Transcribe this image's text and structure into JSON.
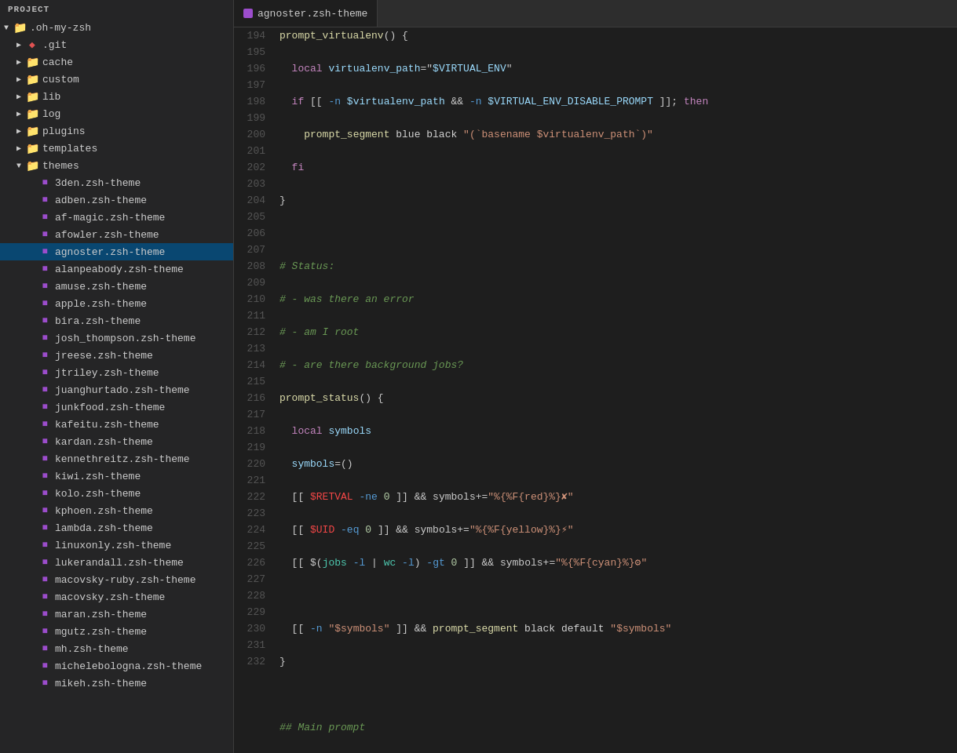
{
  "sidebar": {
    "header": "Project",
    "root": ".oh-my-zsh",
    "items": [
      {
        "id": "git",
        "label": ".git",
        "type": "folder",
        "depth": 1,
        "collapsed": true
      },
      {
        "id": "cache",
        "label": "cache",
        "type": "folder",
        "depth": 1,
        "collapsed": true
      },
      {
        "id": "custom",
        "label": "custom",
        "type": "folder",
        "depth": 1,
        "collapsed": true
      },
      {
        "id": "lib",
        "label": "lib",
        "type": "folder",
        "depth": 1,
        "collapsed": true
      },
      {
        "id": "log",
        "label": "log",
        "type": "folder",
        "depth": 1,
        "collapsed": true
      },
      {
        "id": "plugins",
        "label": "plugins",
        "type": "folder",
        "depth": 1,
        "collapsed": true
      },
      {
        "id": "templates",
        "label": "templates",
        "type": "folder",
        "depth": 1,
        "collapsed": true
      },
      {
        "id": "themes",
        "label": "themes",
        "type": "folder",
        "depth": 1,
        "collapsed": false
      },
      {
        "id": "3den",
        "label": "3den.zsh-theme",
        "type": "file-zsh",
        "depth": 2
      },
      {
        "id": "adben",
        "label": "adben.zsh-theme",
        "type": "file-zsh",
        "depth": 2
      },
      {
        "id": "af-magic",
        "label": "af-magic.zsh-theme",
        "type": "file-zsh",
        "depth": 2
      },
      {
        "id": "afowler",
        "label": "afowler.zsh-theme",
        "type": "file-zsh",
        "depth": 2
      },
      {
        "id": "agnoster",
        "label": "agnoster.zsh-theme",
        "type": "file-zsh",
        "depth": 2,
        "selected": true
      },
      {
        "id": "alanpeabody",
        "label": "alanpeabody.zsh-theme",
        "type": "file-zsh",
        "depth": 2
      },
      {
        "id": "amuse",
        "label": "amuse.zsh-theme",
        "type": "file-zsh",
        "depth": 2
      },
      {
        "id": "apple",
        "label": "apple.zsh-theme",
        "type": "file-zsh",
        "depth": 2
      },
      {
        "id": "bira",
        "label": "bira.zsh-theme",
        "type": "file-zsh",
        "depth": 2
      },
      {
        "id": "josh_thompson",
        "label": "josh_thompson.zsh-theme",
        "type": "file-zsh",
        "depth": 2
      },
      {
        "id": "jreese",
        "label": "jreese.zsh-theme",
        "type": "file-zsh",
        "depth": 2
      },
      {
        "id": "jtriley",
        "label": "jtriley.zsh-theme",
        "type": "file-zsh",
        "depth": 2
      },
      {
        "id": "juanghurtado",
        "label": "juanghurtado.zsh-theme",
        "type": "file-zsh",
        "depth": 2
      },
      {
        "id": "junkfood",
        "label": "junkfood.zsh-theme",
        "type": "file-zsh",
        "depth": 2
      },
      {
        "id": "kafeitu",
        "label": "kafeitu.zsh-theme",
        "type": "file-zsh",
        "depth": 2
      },
      {
        "id": "kardan",
        "label": "kardan.zsh-theme",
        "type": "file-zsh",
        "depth": 2
      },
      {
        "id": "kennethreitz",
        "label": "kennethreitz.zsh-theme",
        "type": "file-zsh",
        "depth": 2
      },
      {
        "id": "kiwi",
        "label": "kiwi.zsh-theme",
        "type": "file-zsh",
        "depth": 2
      },
      {
        "id": "kolo",
        "label": "kolo.zsh-theme",
        "type": "file-zsh",
        "depth": 2
      },
      {
        "id": "kphoen",
        "label": "kphoen.zsh-theme",
        "type": "file-zsh",
        "depth": 2
      },
      {
        "id": "lambda",
        "label": "lambda.zsh-theme",
        "type": "file-zsh",
        "depth": 2
      },
      {
        "id": "linuxonly",
        "label": "linuxonly.zsh-theme",
        "type": "file-zsh",
        "depth": 2
      },
      {
        "id": "lukerandall",
        "label": "lukerandall.zsh-theme",
        "type": "file-zsh",
        "depth": 2
      },
      {
        "id": "macovsky-ruby",
        "label": "macovsky-ruby.zsh-theme",
        "type": "file-zsh",
        "depth": 2
      },
      {
        "id": "macovsky",
        "label": "macovsky.zsh-theme",
        "type": "file-zsh",
        "depth": 2
      },
      {
        "id": "maran",
        "label": "maran.zsh-theme",
        "type": "file-zsh",
        "depth": 2
      },
      {
        "id": "mgutz",
        "label": "mgutz.zsh-theme",
        "type": "file-zsh",
        "depth": 2
      },
      {
        "id": "mh",
        "label": "mh.zsh-theme",
        "type": "file-zsh",
        "depth": 2
      },
      {
        "id": "michelebologna",
        "label": "michelebologna.zsh-theme",
        "type": "file-zsh",
        "depth": 2
      },
      {
        "id": "mikeh",
        "label": "mikeh.zsh-theme",
        "type": "file-zsh",
        "depth": 2
      }
    ]
  },
  "tab": {
    "label": "agnoster.zsh-theme"
  },
  "lines": {
    "start": 194
  }
}
